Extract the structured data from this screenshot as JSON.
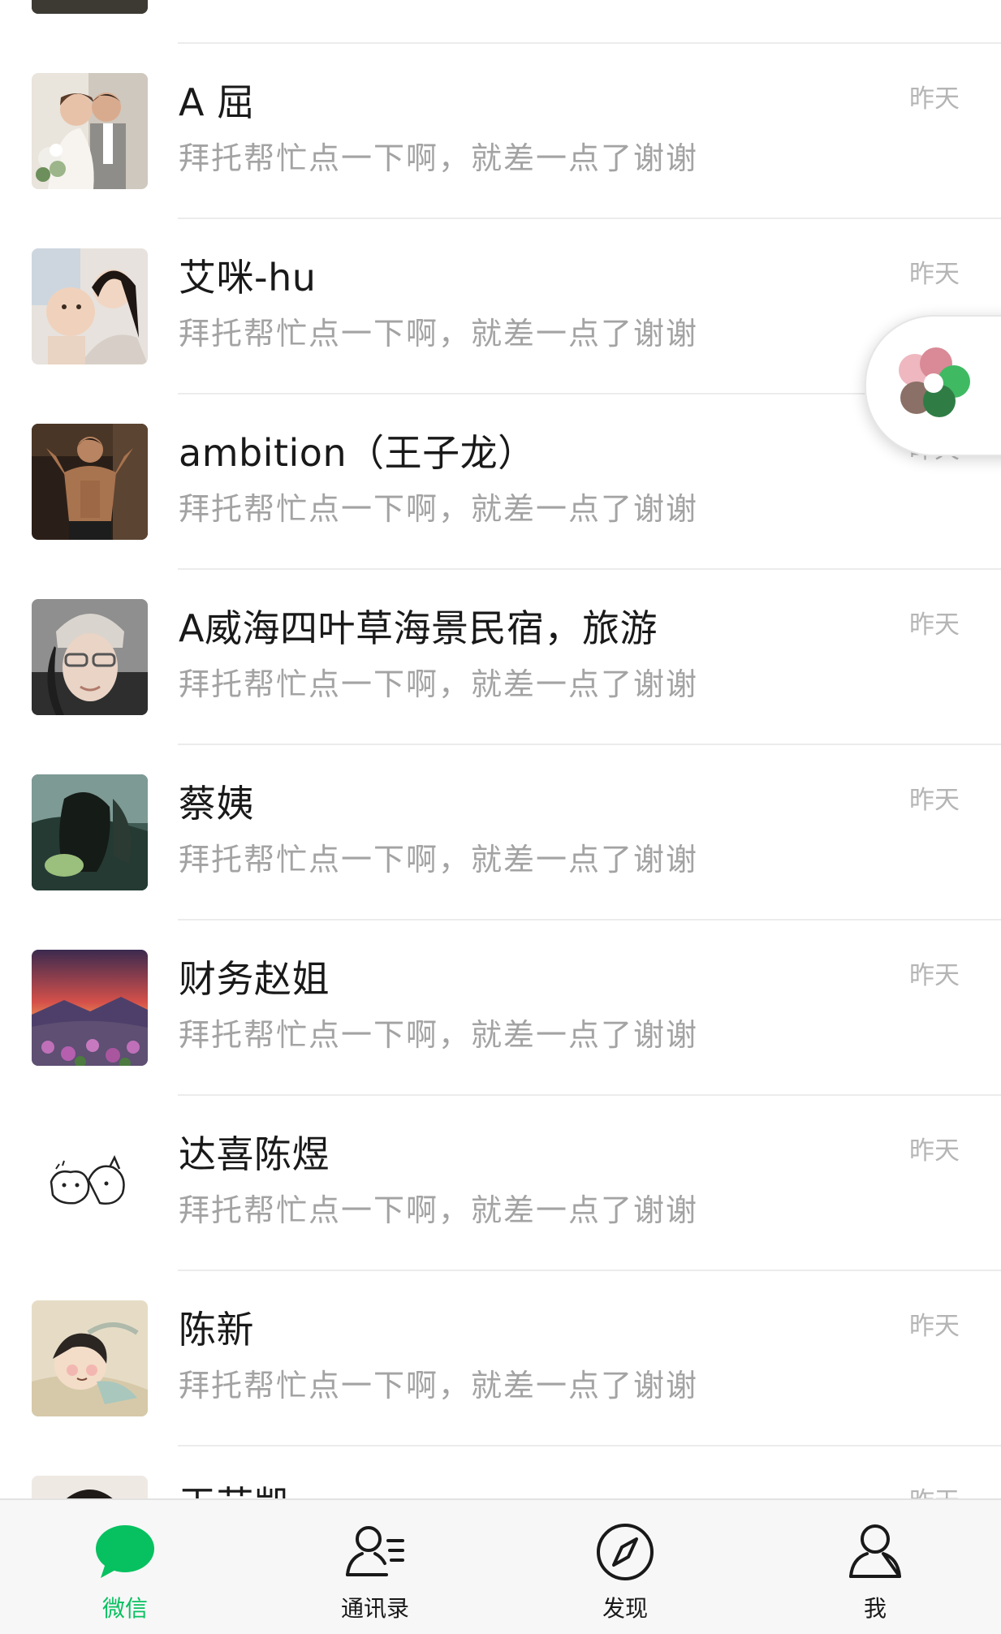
{
  "chats": [
    {
      "name": "",
      "preview": "",
      "time": ""
    },
    {
      "name": "A 屈",
      "preview": "拜托帮忙点一下啊，就差一点了谢谢",
      "time": "昨天"
    },
    {
      "name": "艾咪-hu",
      "preview": "拜托帮忙点一下啊，就差一点了谢谢",
      "time": "昨天"
    },
    {
      "name": "ambition（王子龙）",
      "preview": "拜托帮忙点一下啊，就差一点了谢谢",
      "time": "昨天"
    },
    {
      "name": "A威海四叶草海景民宿，旅游",
      "preview": "拜托帮忙点一下啊，就差一点了谢谢",
      "time": "昨天"
    },
    {
      "name": "蔡姨",
      "preview": "拜托帮忙点一下啊，就差一点了谢谢",
      "time": "昨天"
    },
    {
      "name": "财务赵姐",
      "preview": "拜托帮忙点一下啊，就差一点了谢谢",
      "time": "昨天"
    },
    {
      "name": "达喜陈煜",
      "preview": "拜托帮忙点一下啊，就差一点了谢谢",
      "time": "昨天"
    },
    {
      "name": "陈新",
      "preview": "拜托帮忙点一下啊，就差一点了谢谢",
      "time": "昨天"
    },
    {
      "name": "王芸凯",
      "preview": "",
      "time": "昨天"
    }
  ],
  "tabs": [
    {
      "label": "微信",
      "icon": "chat-bubble-icon",
      "active": true
    },
    {
      "label": "通讯录",
      "icon": "contacts-icon",
      "active": false
    },
    {
      "label": "发现",
      "icon": "compass-icon",
      "active": false
    },
    {
      "label": "我",
      "icon": "person-icon",
      "active": false
    }
  ],
  "colors": {
    "accent": "#07c160",
    "name_text": "#191919",
    "preview_text": "#a3a3a3",
    "time_text": "#b5b5b5",
    "tab_bar_bg": "#f7f7f7"
  },
  "floating_widget": {
    "icon": "floating-window-icon"
  }
}
